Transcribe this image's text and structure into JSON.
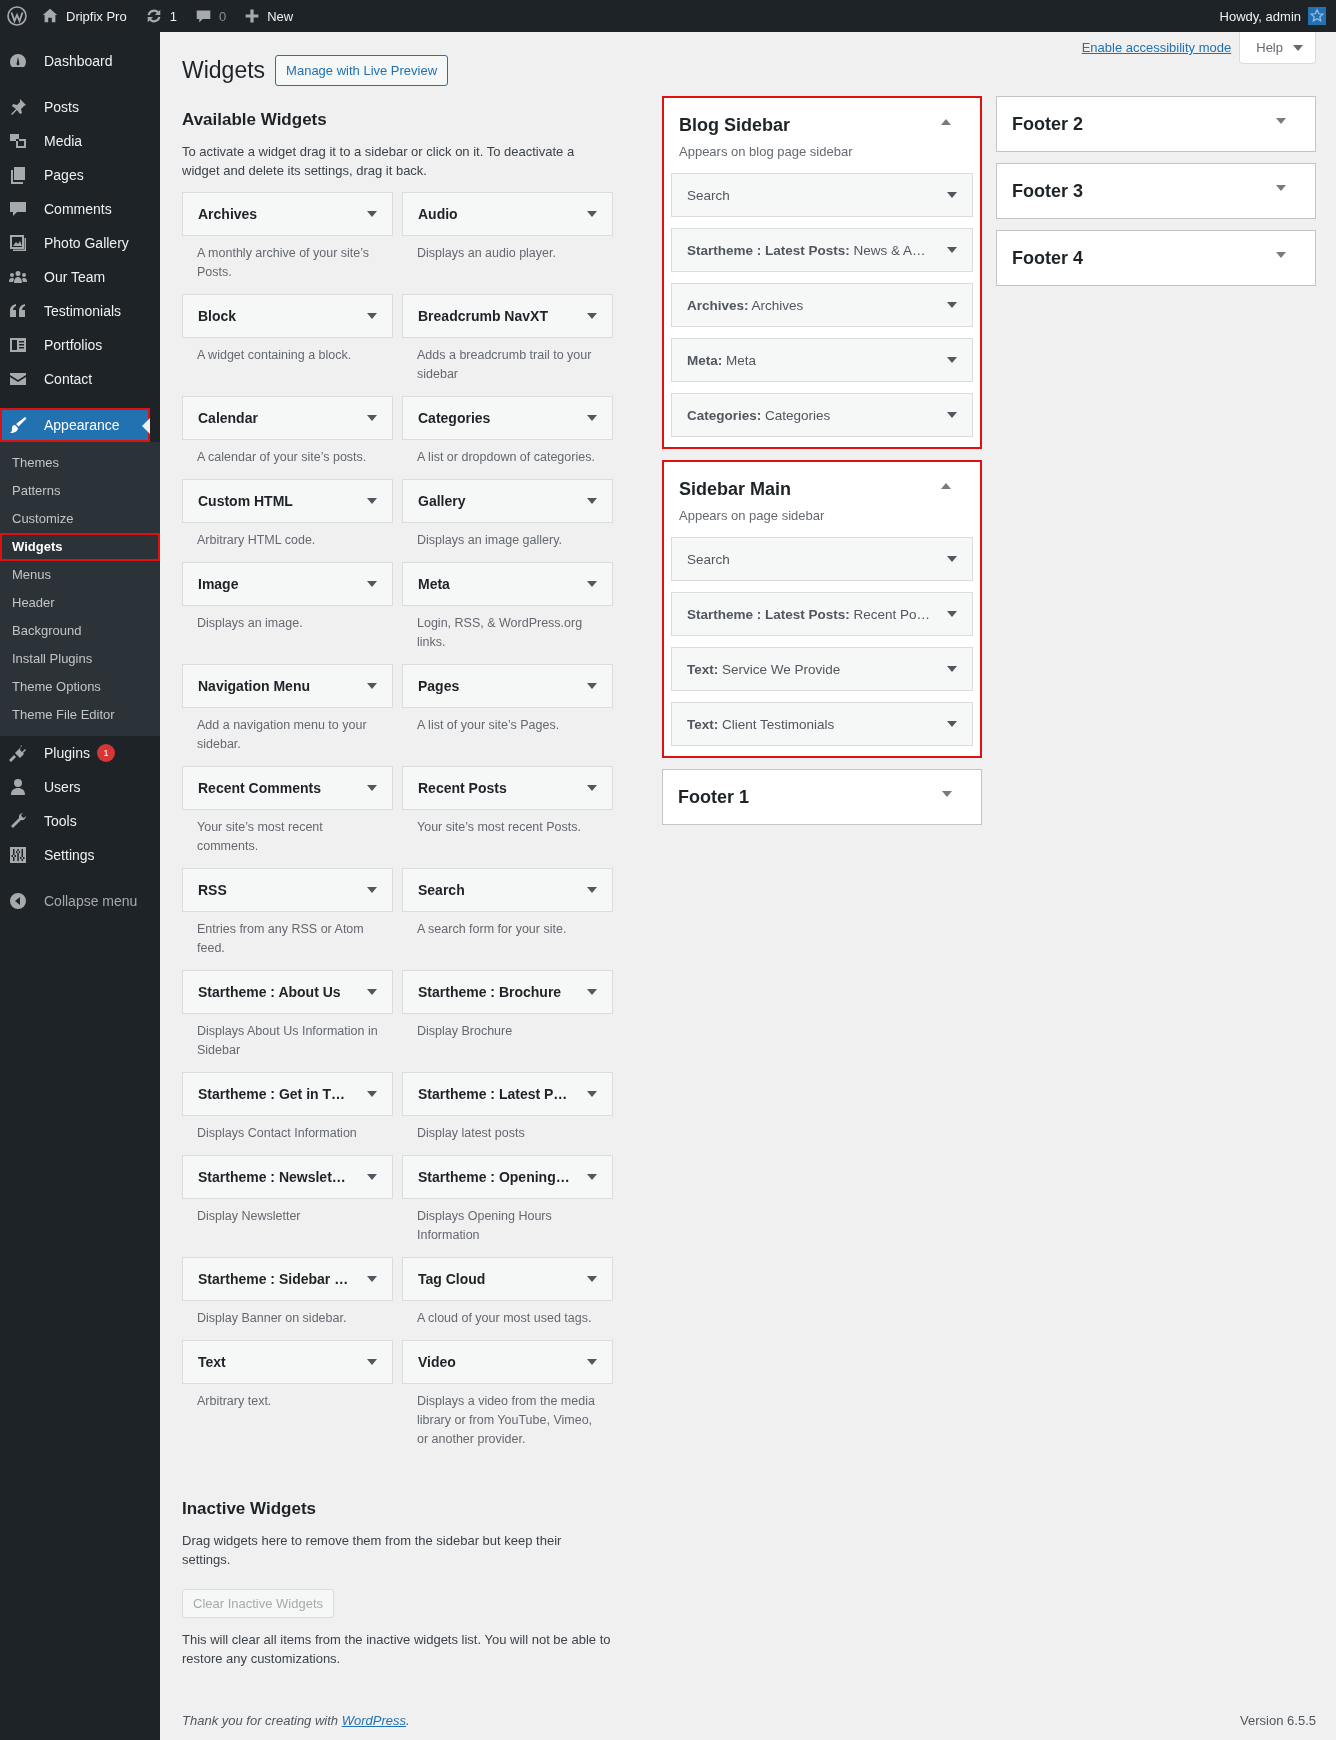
{
  "admin_bar": {
    "site_name": "Dripfix Pro",
    "updates_count": "1",
    "comments_count": "0",
    "new_label": "New",
    "greeting": "Howdy, admin"
  },
  "menu_groups": [
    {
      "items": [
        {
          "label": "Dashboard",
          "selected": false,
          "outlined": false
        }
      ]
    },
    {
      "items": [
        {
          "label": "Posts",
          "selected": false,
          "outlined": false
        },
        {
          "label": "Media",
          "selected": false,
          "outlined": false
        },
        {
          "label": "Pages",
          "selected": false,
          "outlined": false
        },
        {
          "label": "Comments",
          "selected": false,
          "outlined": false
        },
        {
          "label": "Photo Gallery",
          "selected": false,
          "outlined": false
        },
        {
          "label": "Our Team",
          "selected": false,
          "outlined": false
        },
        {
          "label": "Testimonials",
          "selected": false,
          "outlined": false
        },
        {
          "label": "Portfolios",
          "selected": false,
          "outlined": false
        },
        {
          "label": "Contact",
          "selected": false,
          "outlined": false
        }
      ]
    },
    {
      "items": [
        {
          "label": "Appearance",
          "selected": true,
          "outlined": true,
          "children": [
            {
              "label": "Themes",
              "selected": false,
              "outlined": false
            },
            {
              "label": "Patterns",
              "selected": false,
              "outlined": false
            },
            {
              "label": "Customize",
              "selected": false,
              "outlined": false
            },
            {
              "label": "Widgets",
              "selected": true,
              "outlined": true
            },
            {
              "label": "Menus",
              "selected": false,
              "outlined": false
            },
            {
              "label": "Header",
              "selected": false,
              "outlined": false
            },
            {
              "label": "Background",
              "selected": false,
              "outlined": false
            },
            {
              "label": "Install Plugins",
              "selected": false,
              "outlined": false
            },
            {
              "label": "Theme Options",
              "selected": false,
              "outlined": false
            },
            {
              "label": "Theme File Editor",
              "selected": false,
              "outlined": false
            }
          ]
        },
        {
          "label": "Plugins",
          "selected": false,
          "outlined": false,
          "badge": "1"
        },
        {
          "label": "Users",
          "selected": false,
          "outlined": false
        },
        {
          "label": "Tools",
          "selected": false,
          "outlined": false
        },
        {
          "label": "Settings",
          "selected": false,
          "outlined": false
        }
      ]
    }
  ],
  "collapse_label": "Collapse menu",
  "screen_meta": {
    "accessibility_link": "Enable accessibility mode",
    "help_label": "Help"
  },
  "page": {
    "title": "Widgets",
    "action_button": "Manage with Live Preview"
  },
  "available": {
    "heading": "Available Widgets",
    "description": "To activate a widget drag it to a sidebar or click on it. To deactivate a widget and delete its settings, drag it back.",
    "widgets": [
      {
        "name": "Archives",
        "description": "A monthly archive of your site’s Posts."
      },
      {
        "name": "Audio",
        "description": "Displays an audio player."
      },
      {
        "name": "Block",
        "description": "A widget containing a block."
      },
      {
        "name": "Breadcrumb NavXT",
        "description": "Adds a breadcrumb trail to your sidebar"
      },
      {
        "name": "Calendar",
        "description": "A calendar of your site’s posts."
      },
      {
        "name": "Categories",
        "description": "A list or dropdown of categories."
      },
      {
        "name": "Custom HTML",
        "description": "Arbitrary HTML code."
      },
      {
        "name": "Gallery",
        "description": "Displays an image gallery."
      },
      {
        "name": "Image",
        "description": "Displays an image."
      },
      {
        "name": "Meta",
        "description": "Login, RSS, & WordPress.org links."
      },
      {
        "name": "Navigation Menu",
        "description": "Add a navigation menu to your sidebar."
      },
      {
        "name": "Pages",
        "description": "A list of your site’s Pages."
      },
      {
        "name": "Recent Comments",
        "description": "Your site’s most recent comments."
      },
      {
        "name": "Recent Posts",
        "description": "Your site’s most recent Posts."
      },
      {
        "name": "RSS",
        "description": "Entries from any RSS or Atom feed."
      },
      {
        "name": "Search",
        "description": "A search form for your site."
      },
      {
        "name": "Startheme : About Us",
        "description": "Displays About Us Information in Sidebar"
      },
      {
        "name": "Startheme : Brochure",
        "description": "Display Brochure"
      },
      {
        "name": "Startheme : Get in T…",
        "description": "Displays Contact Information"
      },
      {
        "name": "Startheme : Latest P…",
        "description": "Display latest posts"
      },
      {
        "name": "Startheme : Newslet…",
        "description": "Display Newsletter"
      },
      {
        "name": "Startheme : Opening…",
        "description": "Displays Opening Hours Information"
      },
      {
        "name": "Startheme : Sidebar …",
        "description": "Display Banner on sidebar."
      },
      {
        "name": "Tag Cloud",
        "description": "A cloud of your most used tags."
      },
      {
        "name": "Text",
        "description": "Arbitrary text."
      },
      {
        "name": "Video",
        "description": "Displays a video from the media library or from YouTube, Vimeo, or another provider."
      }
    ]
  },
  "inactive": {
    "heading": "Inactive Widgets",
    "description": "Drag widgets here to remove them from the sidebar but keep their settings.",
    "clear_button": {
      "label": "Clear Inactive Widgets",
      "disabled": true
    },
    "note": "This will clear all items from the inactive widgets list. You will not be able to restore any customizations."
  },
  "sidebar_columns": [
    {
      "areas": [
        {
          "title": "Blog Sidebar",
          "expanded": true,
          "outlined": true,
          "description": "Appears on blog page sidebar",
          "widgets": [
            "Search",
            "**Startheme : Latest Posts:** News & A…",
            "**Archives:** Archives",
            "**Meta:** Meta",
            "**Categories:** Categories"
          ]
        },
        {
          "title": "Sidebar Main",
          "expanded": true,
          "outlined": true,
          "description": "Appears on page sidebar",
          "widgets": [
            "Search",
            "**Startheme : Latest Posts:** Recent Po…",
            "**Text:** Service We Provide",
            "**Text:** Client Testimonials"
          ]
        },
        {
          "title": "Footer 1",
          "expanded": false,
          "outlined": false
        }
      ]
    },
    {
      "areas": [
        {
          "title": "Footer 2",
          "expanded": false,
          "outlined": false
        },
        {
          "title": "Footer 3",
          "expanded": false,
          "outlined": false
        },
        {
          "title": "Footer 4",
          "expanded": false,
          "outlined": false
        }
      ]
    }
  ],
  "footer": {
    "thanks_before": "Thank you for creating with ",
    "link": "WordPress",
    "thanks_after": ".",
    "version": "Version 6.5.5"
  }
}
